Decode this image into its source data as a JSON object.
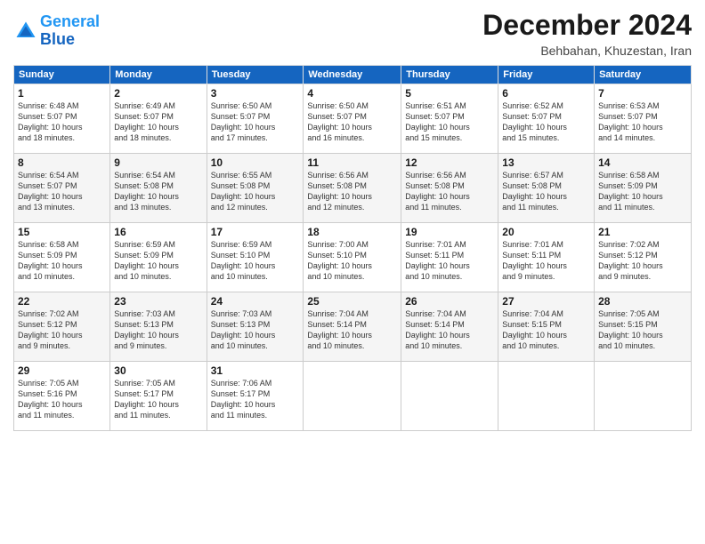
{
  "logo": {
    "line1": "General",
    "line2": "Blue"
  },
  "title": "December 2024",
  "subtitle": "Behbahan, Khuzestan, Iran",
  "days_of_week": [
    "Sunday",
    "Monday",
    "Tuesday",
    "Wednesday",
    "Thursday",
    "Friday",
    "Saturday"
  ],
  "weeks": [
    [
      {
        "day": "1",
        "info": "Sunrise: 6:48 AM\nSunset: 5:07 PM\nDaylight: 10 hours\nand 18 minutes."
      },
      {
        "day": "2",
        "info": "Sunrise: 6:49 AM\nSunset: 5:07 PM\nDaylight: 10 hours\nand 18 minutes."
      },
      {
        "day": "3",
        "info": "Sunrise: 6:50 AM\nSunset: 5:07 PM\nDaylight: 10 hours\nand 17 minutes."
      },
      {
        "day": "4",
        "info": "Sunrise: 6:50 AM\nSunset: 5:07 PM\nDaylight: 10 hours\nand 16 minutes."
      },
      {
        "day": "5",
        "info": "Sunrise: 6:51 AM\nSunset: 5:07 PM\nDaylight: 10 hours\nand 15 minutes."
      },
      {
        "day": "6",
        "info": "Sunrise: 6:52 AM\nSunset: 5:07 PM\nDaylight: 10 hours\nand 15 minutes."
      },
      {
        "day": "7",
        "info": "Sunrise: 6:53 AM\nSunset: 5:07 PM\nDaylight: 10 hours\nand 14 minutes."
      }
    ],
    [
      {
        "day": "8",
        "info": "Sunrise: 6:54 AM\nSunset: 5:07 PM\nDaylight: 10 hours\nand 13 minutes."
      },
      {
        "day": "9",
        "info": "Sunrise: 6:54 AM\nSunset: 5:08 PM\nDaylight: 10 hours\nand 13 minutes."
      },
      {
        "day": "10",
        "info": "Sunrise: 6:55 AM\nSunset: 5:08 PM\nDaylight: 10 hours\nand 12 minutes."
      },
      {
        "day": "11",
        "info": "Sunrise: 6:56 AM\nSunset: 5:08 PM\nDaylight: 10 hours\nand 12 minutes."
      },
      {
        "day": "12",
        "info": "Sunrise: 6:56 AM\nSunset: 5:08 PM\nDaylight: 10 hours\nand 11 minutes."
      },
      {
        "day": "13",
        "info": "Sunrise: 6:57 AM\nSunset: 5:08 PM\nDaylight: 10 hours\nand 11 minutes."
      },
      {
        "day": "14",
        "info": "Sunrise: 6:58 AM\nSunset: 5:09 PM\nDaylight: 10 hours\nand 11 minutes."
      }
    ],
    [
      {
        "day": "15",
        "info": "Sunrise: 6:58 AM\nSunset: 5:09 PM\nDaylight: 10 hours\nand 10 minutes."
      },
      {
        "day": "16",
        "info": "Sunrise: 6:59 AM\nSunset: 5:09 PM\nDaylight: 10 hours\nand 10 minutes."
      },
      {
        "day": "17",
        "info": "Sunrise: 6:59 AM\nSunset: 5:10 PM\nDaylight: 10 hours\nand 10 minutes."
      },
      {
        "day": "18",
        "info": "Sunrise: 7:00 AM\nSunset: 5:10 PM\nDaylight: 10 hours\nand 10 minutes."
      },
      {
        "day": "19",
        "info": "Sunrise: 7:01 AM\nSunset: 5:11 PM\nDaylight: 10 hours\nand 10 minutes."
      },
      {
        "day": "20",
        "info": "Sunrise: 7:01 AM\nSunset: 5:11 PM\nDaylight: 10 hours\nand 9 minutes."
      },
      {
        "day": "21",
        "info": "Sunrise: 7:02 AM\nSunset: 5:12 PM\nDaylight: 10 hours\nand 9 minutes."
      }
    ],
    [
      {
        "day": "22",
        "info": "Sunrise: 7:02 AM\nSunset: 5:12 PM\nDaylight: 10 hours\nand 9 minutes."
      },
      {
        "day": "23",
        "info": "Sunrise: 7:03 AM\nSunset: 5:13 PM\nDaylight: 10 hours\nand 9 minutes."
      },
      {
        "day": "24",
        "info": "Sunrise: 7:03 AM\nSunset: 5:13 PM\nDaylight: 10 hours\nand 10 minutes."
      },
      {
        "day": "25",
        "info": "Sunrise: 7:04 AM\nSunset: 5:14 PM\nDaylight: 10 hours\nand 10 minutes."
      },
      {
        "day": "26",
        "info": "Sunrise: 7:04 AM\nSunset: 5:14 PM\nDaylight: 10 hours\nand 10 minutes."
      },
      {
        "day": "27",
        "info": "Sunrise: 7:04 AM\nSunset: 5:15 PM\nDaylight: 10 hours\nand 10 minutes."
      },
      {
        "day": "28",
        "info": "Sunrise: 7:05 AM\nSunset: 5:15 PM\nDaylight: 10 hours\nand 10 minutes."
      }
    ],
    [
      {
        "day": "29",
        "info": "Sunrise: 7:05 AM\nSunset: 5:16 PM\nDaylight: 10 hours\nand 11 minutes."
      },
      {
        "day": "30",
        "info": "Sunrise: 7:05 AM\nSunset: 5:17 PM\nDaylight: 10 hours\nand 11 minutes."
      },
      {
        "day": "31",
        "info": "Sunrise: 7:06 AM\nSunset: 5:17 PM\nDaylight: 10 hours\nand 11 minutes."
      },
      {
        "day": "",
        "info": ""
      },
      {
        "day": "",
        "info": ""
      },
      {
        "day": "",
        "info": ""
      },
      {
        "day": "",
        "info": ""
      }
    ]
  ]
}
